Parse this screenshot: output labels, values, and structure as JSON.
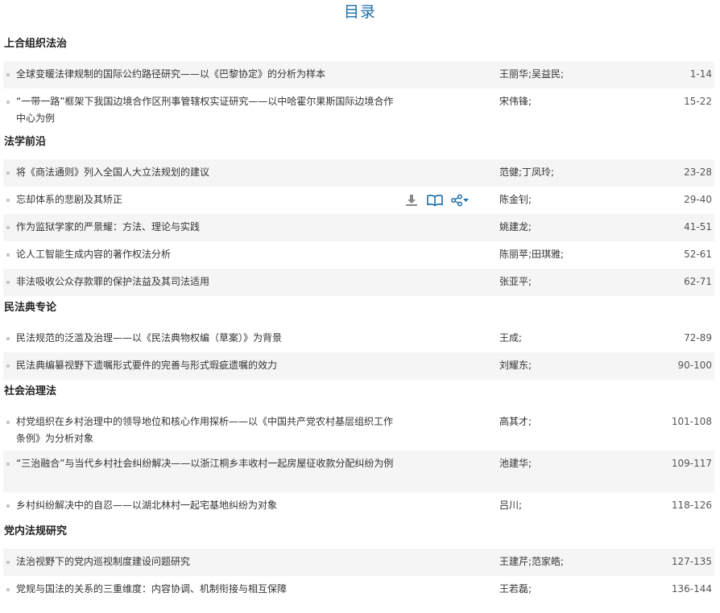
{
  "page": {
    "title": "目录"
  },
  "sections": [
    {
      "title": "上合组织法治",
      "articles": [
        {
          "title": "全球变暖法律规制的国际公约路径研究——以《巴黎协定》的分析为样本",
          "authors": "王丽华;吴益民;",
          "pages": "1-14"
        },
        {
          "title": "“一带一路”框架下我国边境合作区刑事管辖权实证研究——以中哈霍尔果斯国际边境合作中心为例",
          "authors": "宋伟锋;",
          "pages": "15-22"
        }
      ]
    },
    {
      "title": "法学前沿",
      "articles": [
        {
          "title": "将《商法通则》列入全国人大立法规划的建议",
          "authors": "范健;丁凤玲;",
          "pages": "23-28"
        },
        {
          "title": "忘却体系的悲剧及其矫正",
          "authors": "陈金钊;",
          "pages": "29-40"
        },
        {
          "title": "作为监狱学家的严景耀：方法、理论与实践",
          "authors": "姚建龙;",
          "pages": "41-51"
        },
        {
          "title": "论人工智能生成内容的著作权法分析",
          "authors": "陈丽苹;田琪雅;",
          "pages": "52-61"
        },
        {
          "title": "非法吸收公众存款罪的保护法益及其司法适用",
          "authors": "张亚平;",
          "pages": "62-71"
        }
      ]
    },
    {
      "title": "民法典专论",
      "articles": [
        {
          "title": "民法规范的泛滥及治理——以《民法典物权编（草案）》为背景",
          "authors": "王成;",
          "pages": "72-89"
        },
        {
          "title": "民法典编纂视野下遗嘱形式要件的完善与形式瑕疵遗嘱的效力",
          "authors": "刘耀东;",
          "pages": "90-100"
        }
      ]
    },
    {
      "title": "社会治理法",
      "articles": [
        {
          "title": "村党组织在乡村治理中的领导地位和核心作用探析——以《中国共产党农村基层组织工作条例》为分析对象",
          "authors": "高其才;",
          "pages": "101-108"
        },
        {
          "title": "“三治融合”与当代乡村社会纠纷解决——以浙江桐乡丰收村一起房屋征收款分配纠纷为例",
          "authors": "池建华;",
          "pages": "109-117"
        },
        {
          "title": "乡村纠纷解决中的自忍——以湖北林村一起宅基地纠纷为对象",
          "authors": "吕川;",
          "pages": "118-126"
        }
      ]
    },
    {
      "title": "党内法规研究",
      "articles": [
        {
          "title": "法治视野下的党内巡视制度建设问题研究",
          "authors": "王建芹;范家皓;",
          "pages": "127-135"
        },
        {
          "title": "党规与国法的关系的三重维度：内容协调、机制衔接与相互保障",
          "authors": "王若磊;",
          "pages": "136-144"
        }
      ]
    }
  ],
  "hover_actions": {
    "icons": [
      "download-icon",
      "read-online-icon",
      "share-icon",
      "caret-down-icon"
    ],
    "colors": {
      "icon": "#1b6ea8",
      "download": "#888888"
    }
  },
  "colors": {
    "title": "#1b6ea8",
    "row_shade": "#f5f5f5",
    "bullet": "#c8c8c8"
  }
}
